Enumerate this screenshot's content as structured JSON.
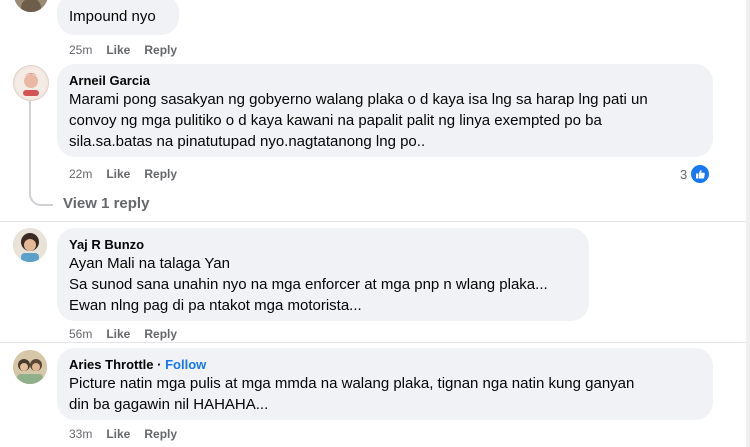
{
  "comments": [
    {
      "author": "",
      "lines": [
        "Impound nyo"
      ],
      "time": "25m"
    },
    {
      "author": "Arneil Garcia",
      "lines": [
        "Marami pong sasakyan ng gobyerno walang plaka o d kaya isa lng sa harap lng pati un",
        "convoy ng mga pulitiko o d kaya kawani na papalit palit ng linya exempted po ba",
        "sila.sa.batas na pinatutupad nyo.nagtatanong lng po.."
      ],
      "time": "22m",
      "reaction_count": "3",
      "reaction_icon": "like-icon",
      "view_replies": "View 1 reply"
    },
    {
      "author": "Yaj R Bunzo",
      "lines": [
        "Ayan Mali na talaga Yan",
        "Sa sunod sana unahin nyo na mga enforcer at mga pnp n wlang plaka...",
        "Ewan nlng pag di pa ntakot mga motorista..."
      ],
      "time": "56m"
    },
    {
      "author": "Aries Throttle",
      "separator": "·",
      "follow": "Follow",
      "lines": [
        "Picture natin mga pulis at mga mmda na walang plaka, tignan nga natin kung ganyan",
        "din ba gagawin nil HAHAHA..."
      ],
      "time": "33m"
    }
  ],
  "actions": {
    "like": "Like",
    "reply": "Reply"
  },
  "colors": {
    "bubble": "#f0f2f5",
    "meta": "#65676b",
    "accent": "#1877f2"
  }
}
